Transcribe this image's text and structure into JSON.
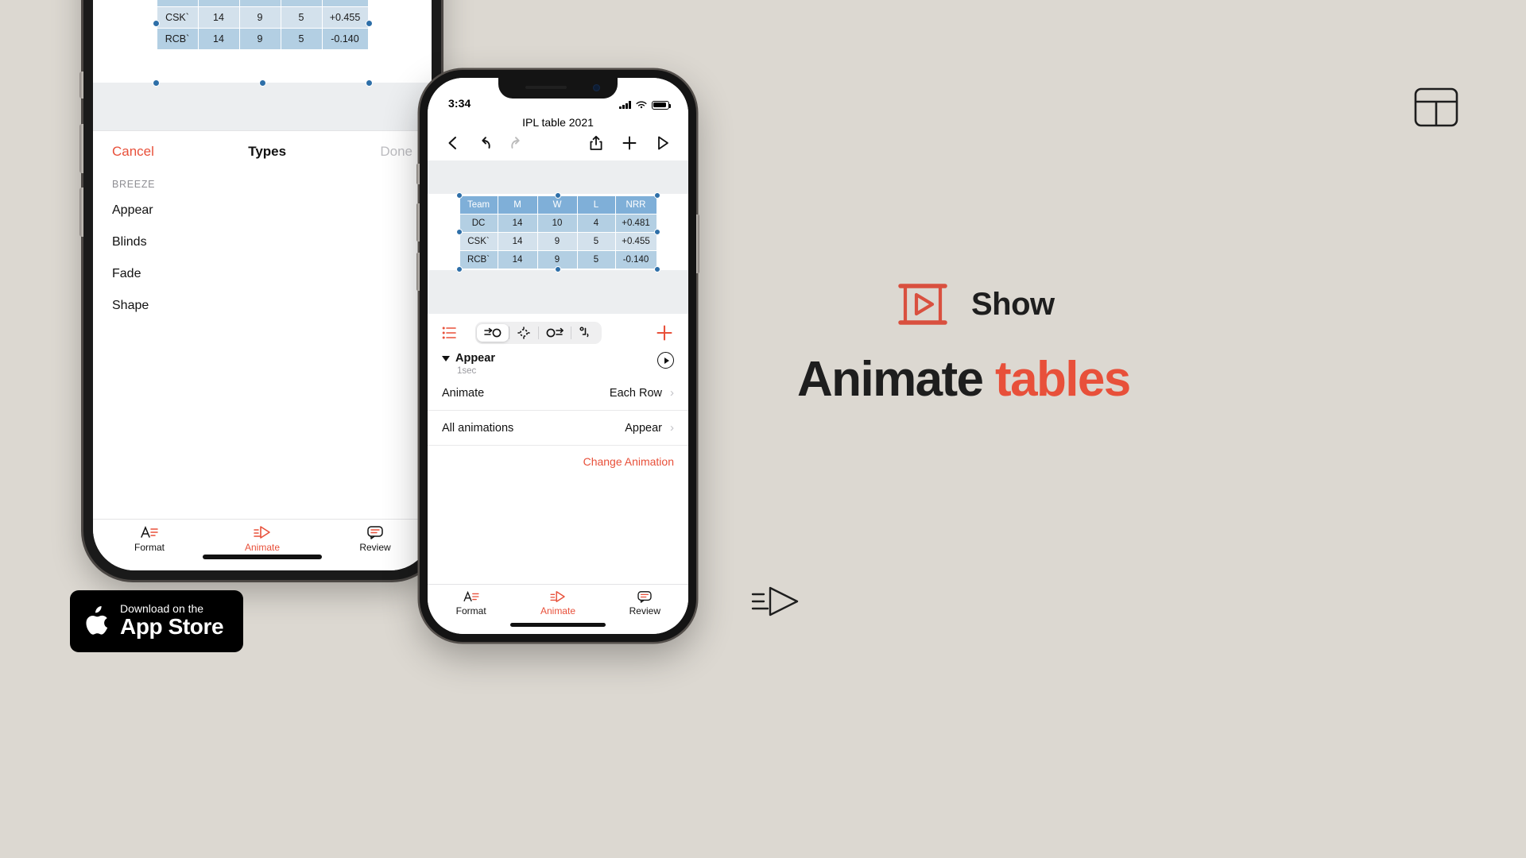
{
  "background_color": "#dcd8d1",
  "accent_color": "#e8503a",
  "marketing": {
    "brand_name": "Show",
    "headline_part1": "Animate ",
    "headline_part2": "tables",
    "logo_icon": "show-play-frame-icon",
    "table_icon": "table-glyph-icon",
    "arrow_icon": "animate-arrow-icon",
    "appstore": {
      "line1": "Download on the",
      "line2": "App Store",
      "apple_icon": "apple-logo-icon"
    }
  },
  "table": {
    "headers": [
      "Team",
      "M",
      "W",
      "L",
      "NRR"
    ],
    "rows": [
      [
        "DC",
        "14",
        "10",
        "4",
        "+0.481"
      ],
      [
        "CSK`",
        "14",
        "9",
        "5",
        "+0.455"
      ],
      [
        "RCB`",
        "14",
        "9",
        "5",
        "-0.140"
      ]
    ],
    "header_bg": "#7fafd8",
    "row_bg_a": "#b3cfe3",
    "row_bg_b": "#d3e1ec",
    "handle_color": "#2e6fa8"
  },
  "right_phone": {
    "status": {
      "time": "3:34",
      "signal_icon": "cellular-signal-icon",
      "wifi_icon": "wifi-icon",
      "battery_icon": "battery-full-icon"
    },
    "doc_title": "IPL table 2021",
    "toolbar": {
      "back_icon": "chevron-left-icon",
      "undo_icon": "undo-icon",
      "redo_icon": "redo-icon",
      "share_icon": "share-icon",
      "add_icon": "plus-icon",
      "play_icon": "play-triangle-icon"
    },
    "inspector": {
      "list_icon": "bullet-list-icon",
      "segments": [
        {
          "icon": "build-in-icon",
          "active": true
        },
        {
          "icon": "action-icon",
          "active": false
        },
        {
          "icon": "build-out-icon",
          "active": false
        },
        {
          "icon": "transition-icon",
          "active": false
        }
      ],
      "add_icon": "plus-icon",
      "group_title": "Appear",
      "group_duration": "1sec",
      "preview_icon": "play-circle-icon",
      "rows": [
        {
          "label": "Animate",
          "value": "Each Row",
          "chevron": "chevron-right-icon"
        },
        {
          "label": "All animations",
          "value": "Appear",
          "chevron": "chevron-right-icon"
        }
      ],
      "change_animation": "Change Animation"
    },
    "tabbar": [
      {
        "label": "Format",
        "icon": "format-text-icon",
        "active": false
      },
      {
        "label": "Animate",
        "icon": "animate-arrow-icon",
        "active": true
      },
      {
        "label": "Review",
        "icon": "comment-icon",
        "active": false
      }
    ]
  },
  "left_phone": {
    "sheet": {
      "cancel": "Cancel",
      "title": "Types",
      "done": "Done",
      "section_label": "BREEZE",
      "items": [
        "Appear",
        "Blinds",
        "Fade",
        "Shape"
      ]
    },
    "tabbar": [
      {
        "label": "Format",
        "icon": "format-text-icon",
        "active": false
      },
      {
        "label": "Animate",
        "icon": "animate-arrow-icon",
        "active": true
      },
      {
        "label": "Review",
        "icon": "comment-icon",
        "active": false
      }
    ]
  }
}
